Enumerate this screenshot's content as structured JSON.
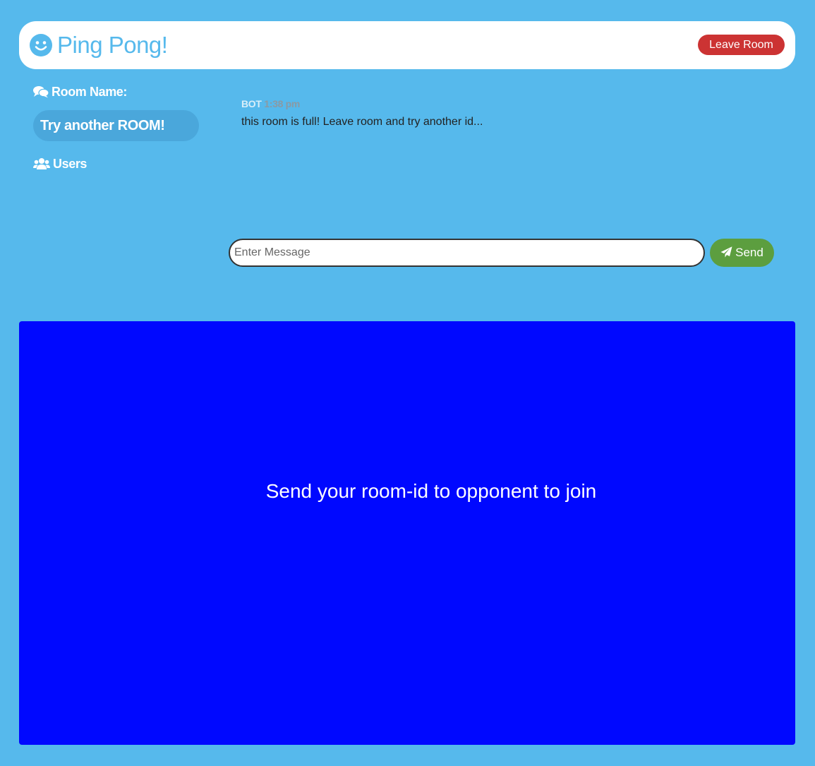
{
  "header": {
    "title": "Ping Pong!",
    "logo_icon": "smile-icon",
    "leave_label": "Leave Room"
  },
  "sidebar": {
    "room_heading": "Room Name:",
    "room_heading_icon": "comments-icon",
    "room_name": "Try another ROOM!",
    "users_heading": "Users",
    "users_heading_icon": "users-icon"
  },
  "chat": {
    "messages": [
      {
        "author": "BOT",
        "time": "1:38 pm",
        "text": "this room is full! Leave room and try another id..."
      }
    ],
    "input_value": "",
    "input_placeholder": "Enter Message",
    "send_label": "Send",
    "send_icon": "paper-plane-icon"
  },
  "game": {
    "message": "Send your room-id to opponent to join"
  },
  "colors": {
    "background": "#56b9ec",
    "leave_button": "#cc3333",
    "send_button": "#5c9e3f",
    "game_area": "#0008ff"
  }
}
